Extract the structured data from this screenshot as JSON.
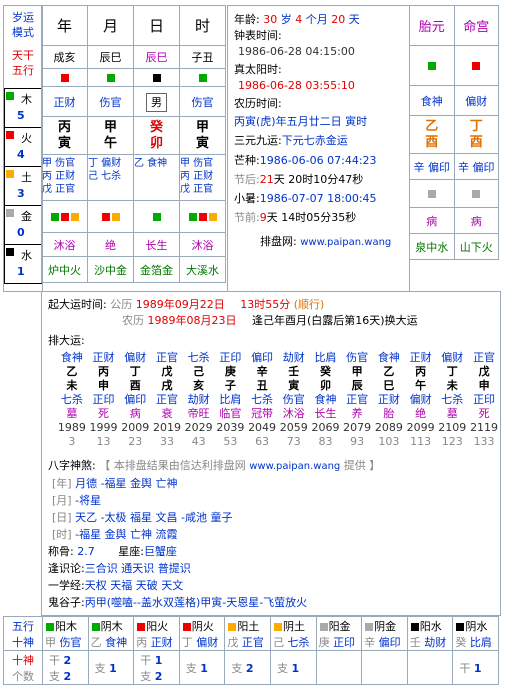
{
  "colors": {
    "wood": "#00aa00",
    "fire": "#ee0000",
    "earth": "#ffaa00",
    "metal": "#aaaaaa",
    "water": "#000000"
  },
  "left": {
    "title1": "岁运",
    "title2": "模式",
    "gan": "天干",
    "wu": "五行",
    "elems": [
      {
        "n": "木",
        "v": "5"
      },
      {
        "n": "火",
        "v": "4"
      },
      {
        "n": "土",
        "v": "3"
      },
      {
        "n": "金",
        "v": "0"
      },
      {
        "n": "水",
        "v": "1"
      }
    ]
  },
  "pillars": {
    "headers": [
      "年",
      "月",
      "日",
      "时"
    ],
    "nayin_row": [
      "成亥",
      "辰巳",
      "辰巳",
      "子丑"
    ],
    "colors": [
      "fire",
      "wood",
      "water",
      "wood"
    ],
    "shishen": [
      "正财",
      "伤官",
      "男",
      "伤官"
    ],
    "gan": [
      "丙",
      "甲",
      "癸",
      "甲"
    ],
    "zhi": [
      "寅",
      "午",
      "卯",
      "寅"
    ],
    "cang": [
      [
        "甲 伤官",
        "丙 正财",
        "戊 正官"
      ],
      [
        "丁 偏财",
        "己 七杀",
        ""
      ],
      [
        "乙 食神",
        "",
        ""
      ],
      [
        "甲 伤官",
        "丙 正财",
        "戊 正官"
      ]
    ],
    "twelve": [
      "沐浴",
      "绝",
      "长生",
      "沐浴"
    ],
    "nayin": [
      "炉中火",
      "沙中金",
      "金箔金",
      "大溪水"
    ]
  },
  "info": {
    "age_label": "年龄:",
    "age_y": "30",
    "age_y_u": "岁",
    "age_m": "4",
    "age_m_u": "个月",
    "age_d": "20",
    "age_d_u": "天",
    "clock_label": "钟表时间:",
    "clock": "1986-06-28 04:15:00",
    "solar_label": "真太阳时:",
    "solar": "1986-06-28 03:55:10",
    "lunar_label": "农历时间:",
    "lunar": "丙寅(虎)年五月廿二日 寅时",
    "sanyuan_label": "三元九运:",
    "sanyuan": "下元七赤金运",
    "mangzhong_label": "芒种:",
    "mangzhong": "1986-06-06 07:44:23",
    "jq_after": "节后:",
    "jq_after_d": "21",
    "jq_after_rest": "天 20时10分47秒",
    "xiaoshu_label": "小暑:",
    "xiaoshu": "1986-07-07 18:00:45",
    "jq_before": "节前:",
    "jq_before_d": "9",
    "jq_before_rest": "天 14时05分35秒",
    "site_label": "排盘网:",
    "site": "www.paipan.wang"
  },
  "right": {
    "h1": "胎元",
    "h2": "命宫",
    "colors": [
      "wood",
      "fire"
    ],
    "shishen": [
      "食神",
      "偏财"
    ],
    "gan": [
      "乙",
      "丁"
    ],
    "zhi": [
      "酉",
      "酉"
    ],
    "cang": [
      "辛 偏印",
      "辛 偏印"
    ],
    "twelve": [
      "病",
      "病"
    ],
    "nayin": [
      "泉中水",
      "山下火"
    ]
  },
  "dayun": {
    "start_label": "起大运时间:",
    "gl": "公历",
    "gl_date": "1989年09月22日",
    "gl_time": "13时55分",
    "gl_dir": "(顺行)",
    "nl": "农历",
    "nl_date": "1989年08月23日",
    "nl_rest": "逢己年酉月(白露后第16天)换大运",
    "label": "排大运:",
    "cols": [
      {
        "ss": "食神",
        "g": "乙",
        "z": "未",
        "ss2": "七杀",
        "st": "墓",
        "y": "1989",
        "a": "3"
      },
      {
        "ss": "正财",
        "g": "丙",
        "z": "申",
        "ss2": "正印",
        "st": "死",
        "y": "1999",
        "a": "13"
      },
      {
        "ss": "偏财",
        "g": "丁",
        "z": "酉",
        "ss2": "偏印",
        "st": "病",
        "y": "2009",
        "a": "23"
      },
      {
        "ss": "正官",
        "g": "戊",
        "z": "戌",
        "ss2": "正官",
        "st": "衰",
        "y": "2019",
        "a": "33"
      },
      {
        "ss": "七杀",
        "g": "己",
        "z": "亥",
        "ss2": "劫财",
        "st": "帝旺",
        "y": "2029",
        "a": "43"
      },
      {
        "ss": "正印",
        "g": "庚",
        "z": "子",
        "ss2": "比肩",
        "st": "临官",
        "y": "2039",
        "a": "53"
      },
      {
        "ss": "偏印",
        "g": "辛",
        "z": "丑",
        "ss2": "七杀",
        "st": "冠带",
        "y": "2049",
        "a": "63"
      },
      {
        "ss": "劫财",
        "g": "壬",
        "z": "寅",
        "ss2": "伤官",
        "st": "沐浴",
        "y": "2059",
        "a": "73"
      },
      {
        "ss": "比肩",
        "g": "癸",
        "z": "卯",
        "ss2": "食神",
        "st": "长生",
        "y": "2069",
        "a": "83"
      },
      {
        "ss": "伤官",
        "g": "甲",
        "z": "辰",
        "ss2": "正官",
        "st": "养",
        "y": "2079",
        "a": "93"
      },
      {
        "ss": "食神",
        "g": "乙",
        "z": "巳",
        "ss2": "正财",
        "st": "胎",
        "y": "2089",
        "a": "103"
      },
      {
        "ss": "正财",
        "g": "丙",
        "z": "午",
        "ss2": "偏财",
        "st": "绝",
        "y": "2099",
        "a": "113"
      },
      {
        "ss": "偏财",
        "g": "丁",
        "z": "未",
        "ss2": "七杀",
        "st": "墓",
        "y": "2109",
        "a": "123"
      },
      {
        "ss": "正官",
        "g": "戊",
        "z": "申",
        "ss2": "正印",
        "st": "死",
        "y": "2119",
        "a": "133"
      }
    ]
  },
  "shensha": {
    "label": "八字神煞:",
    "note": "【 本排盘结果由信达利排盘网",
    "site": "www.paipan.wang",
    "note2": "提供 】",
    "rows": [
      {
        "k": "[年]",
        "v": "月德 -福星 金舆 亡神"
      },
      {
        "k": "[月]",
        "v": "-将星"
      },
      {
        "k": "[日]",
        "v": "天乙 -太极 福星 文昌 -咸池 童子"
      },
      {
        "k": "[时]",
        "v": "-福星 金舆 亡神 流霞"
      }
    ],
    "chenggu_label": "称骨:",
    "chenggu": "2.7",
    "xingzuo_label": "星座:",
    "xingzuo": "巨蟹座",
    "fengshi_label": "逢识论:",
    "fengshi": "三合识 通天识 普提识",
    "yixue_label": "一学经:",
    "yixue": "天权 天福 天破 天文",
    "guigu_label": "鬼谷子:",
    "guigu": "丙甲(噬嗑--盖水双莲格)甲寅-天恩星-飞萤放火"
  },
  "bottom": {
    "wx_label": "五行",
    "ss_label": "十神",
    "sl_label": "十神",
    "count_label": "个数",
    "cells": [
      {
        "c": "wood",
        "t": "阳木",
        "g": "甲",
        "ss": "伤官"
      },
      {
        "c": "wood",
        "t": "阴木",
        "g": "乙",
        "ss": "食神"
      },
      {
        "c": "fire",
        "t": "阳火",
        "g": "丙",
        "ss": "正财"
      },
      {
        "c": "fire",
        "t": "阴火",
        "g": "丁",
        "ss": "偏财"
      },
      {
        "c": "earth",
        "t": "阳土",
        "g": "戊",
        "ss": "正官"
      },
      {
        "c": "earth",
        "t": "阴土",
        "g": "己",
        "ss": "七杀"
      },
      {
        "c": "metal",
        "t": "阳金",
        "g": "庚",
        "ss": "正印"
      },
      {
        "c": "metal",
        "t": "阴金",
        "g": "辛",
        "ss": "偏印"
      },
      {
        "c": "water",
        "t": "阳水",
        "g": "壬",
        "ss": "劫财"
      },
      {
        "c": "water",
        "t": "阴水",
        "g": "癸",
        "ss": "比肩"
      }
    ],
    "counts": [
      {
        "gl": "干",
        "g": "2",
        "zl": "支",
        "z": "2"
      },
      {
        "gl": "",
        "g": "",
        "zl": "支",
        "z": "1"
      },
      {
        "gl": "干",
        "g": "1",
        "zl": "支",
        "z": "2"
      },
      {
        "gl": "",
        "g": "",
        "zl": "支",
        "z": "1"
      },
      {
        "gl": "",
        "g": "",
        "zl": "支",
        "z": "2"
      },
      {
        "gl": "",
        "g": "",
        "zl": "支",
        "z": "1"
      },
      {
        "gl": "",
        "g": "",
        "zl": "",
        "z": ""
      },
      {
        "gl": "",
        "g": "",
        "zl": "",
        "z": ""
      },
      {
        "gl": "",
        "g": "",
        "zl": "",
        "z": ""
      },
      {
        "gl": "干",
        "g": "1",
        "zl": "",
        "z": ""
      }
    ]
  }
}
